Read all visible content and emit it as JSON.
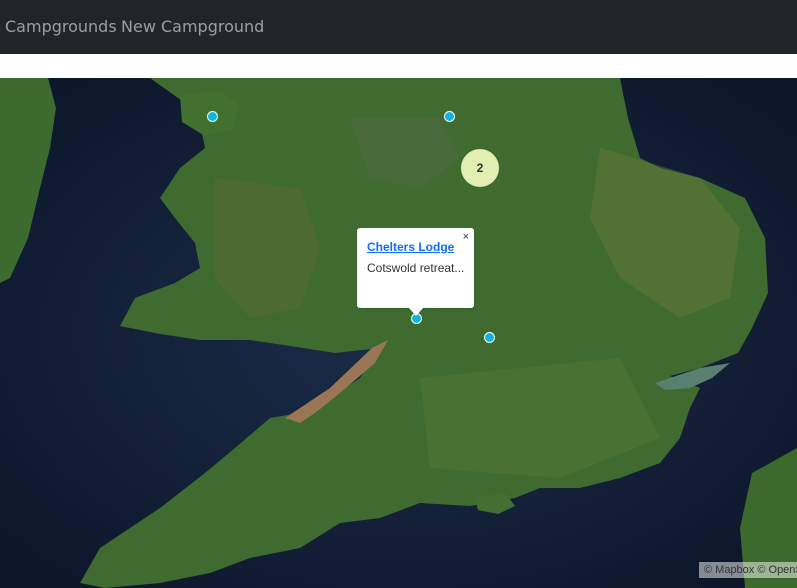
{
  "navbar": {
    "links": [
      "Campgrounds",
      "New Campground"
    ]
  },
  "map": {
    "cluster": {
      "count": "2",
      "color": "#e3efb2"
    },
    "marker_color": "#11b4da",
    "popup": {
      "close": "×",
      "title": "Chelters Lodge",
      "description": "Cotswold retreat..."
    },
    "attribution": "© Mapbox © OpenStreetMap"
  },
  "colors": {
    "navbar": "#212529",
    "link": "#0d6efd"
  }
}
